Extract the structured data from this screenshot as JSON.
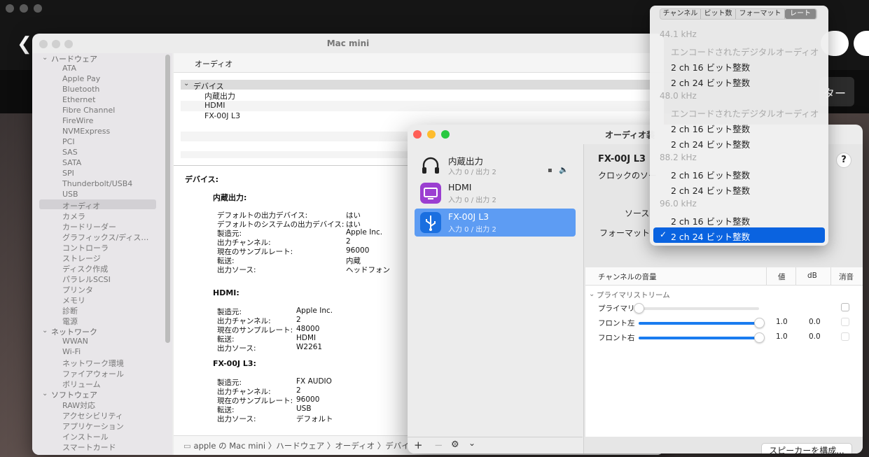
{
  "sysinfo": {
    "title": "Mac mini",
    "sidebar": {
      "categories": [
        {
          "label": "ハードウェア",
          "items": [
            "ATA",
            "Apple Pay",
            "Bluetooth",
            "Ethernet",
            "Fibre Channel",
            "FireWire",
            "NVMExpress",
            "PCI",
            "SAS",
            "SATA",
            "SPI",
            "Thunderbolt/USB4",
            "USB",
            "オーディオ",
            "カメラ",
            "カードリーダー",
            "グラフィックス/ディス…",
            "コントローラ",
            "ストレージ",
            "ディスク作成",
            "パラレルSCSI",
            "プリンタ",
            "メモリ",
            "診断",
            "電源"
          ]
        },
        {
          "label": "ネットワーク",
          "items": [
            "WWAN",
            "Wi-Fi",
            "ネットワーク環境",
            "ファイアウォール",
            "ボリューム"
          ]
        },
        {
          "label": "ソフトウェア",
          "items": [
            "RAW対応",
            "アクセシビリティ",
            "アプリケーション",
            "インストール",
            "スマートカード"
          ]
        }
      ],
      "selected": "オーディオ"
    },
    "header": {
      "label": "オーディオ"
    },
    "list": {
      "group": "デバイス",
      "items": [
        "内蔵出力",
        "HDMI",
        "FX-00J L3"
      ]
    },
    "detail": {
      "heading": "デバイス:",
      "sections": [
        {
          "title": "内蔵出力:",
          "rows": [
            [
              "デフォルトの出力デバイス:",
              "はい"
            ],
            [
              "デフォルトのシステムの出力デバイス:",
              "はい"
            ],
            [
              "製造元:",
              "Apple Inc."
            ],
            [
              "出力チャンネル:",
              "2"
            ],
            [
              "現在のサンプルレート:",
              "96000"
            ],
            [
              "転送:",
              "内蔵"
            ],
            [
              "出力ソース:",
              "ヘッドフォン"
            ]
          ]
        },
        {
          "title": "HDMI:",
          "rows": [
            [
              "製造元:",
              "Apple Inc."
            ],
            [
              "出力チャンネル:",
              "2"
            ],
            [
              "現在のサンプルレート:",
              "48000"
            ],
            [
              "転送:",
              "HDMI"
            ],
            [
              "出力ソース:",
              "W2261"
            ]
          ]
        },
        {
          "title": "FX-00J L3:",
          "rows": [
            [
              "製造元:",
              "FX AUDIO"
            ],
            [
              "出力チャンネル:",
              "2"
            ],
            [
              "現在のサンプルレート:",
              "96000"
            ],
            [
              "転送:",
              "USB"
            ],
            [
              "出力ソース:",
              "デフォルト"
            ]
          ]
        }
      ]
    },
    "breadcrumb": "apple の Mac mini 〉ハードウェア 〉オーディオ 〉デバイス"
  },
  "background": {
    "tag": "ター"
  },
  "amidi": {
    "title": "オーディオ装",
    "devices": [
      {
        "name": "内蔵出力",
        "sub": "入力 0 / 出力 2"
      },
      {
        "name": "HDMI",
        "sub": "入力 0 / 出力 2"
      },
      {
        "name": "FX-00J L3",
        "sub": "入力 0 / 出力 2"
      }
    ],
    "toolbar": {
      "add": "+",
      "remove": "−",
      "gear": "⚙",
      "chev": "⌄"
    },
    "detail": {
      "device_title": "FX-00J L3",
      "clock_label": "クロックのソー",
      "source_label": "ソース",
      "format_label": "フォーマット",
      "help": "?"
    },
    "table": {
      "headers": {
        "channel": "チャンネルの音量",
        "value": "値",
        "db": "dB",
        "mute": "消音"
      },
      "group": "プライマリストリーム",
      "rows": [
        {
          "name": "プライマリ",
          "value": "",
          "db": "",
          "level": 0.0
        },
        {
          "name": "フロント左",
          "value": "1.0",
          "db": "0.0",
          "level": 1.0
        },
        {
          "name": "フロント右",
          "value": "1.0",
          "db": "0.0",
          "level": 1.0
        }
      ]
    },
    "config_button": "スピーカーを構成..."
  },
  "dropdown": {
    "tabs": [
      "チャンネル",
      "ビット数",
      "フォーマット",
      "レート"
    ],
    "active_tab": "レート",
    "groups": [
      {
        "rate": "44.1 kHz",
        "items": [
          "エンコードされたデジタルオーディオ",
          "2 ch 16 ビット整数",
          "2 ch 24 ビット整数"
        ]
      },
      {
        "rate": "48.0 kHz",
        "items": [
          "エンコードされたデジタルオーディオ",
          "2 ch 16 ビット整数",
          "2 ch 24 ビット整数"
        ]
      },
      {
        "rate": "88.2 kHz",
        "items": [
          "2 ch 16 ビット整数",
          "2 ch 24 ビット整数"
        ]
      },
      {
        "rate": "96.0 kHz",
        "items": [
          "2 ch 16 ビット整数",
          "2 ch 24 ビット整数"
        ]
      }
    ],
    "selected": "2 ch 24 ビット整数",
    "checkmark": "✓"
  },
  "colors": {
    "accent": "#0a63e0",
    "selection_row": "#5d9cf3",
    "slider_fill": "#1a7cf0"
  }
}
